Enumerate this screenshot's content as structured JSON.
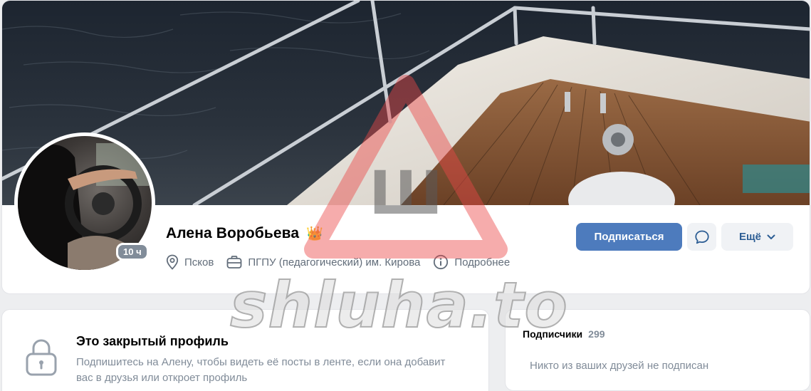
{
  "profile": {
    "name": "Алена Воробьева",
    "name_badge_icon": "crown-icon",
    "online_badge": "10 ч",
    "location": "Псков",
    "education": "ПГПУ (педагогический) им. Кирова",
    "more_info": "Подробнее"
  },
  "actions": {
    "subscribe": "Подписаться",
    "more": "Ещё"
  },
  "closed_profile": {
    "title": "Это закрытый профиль",
    "text": "Подпишитесь на Алену, чтобы видеть её посты в ленте, если она добавит вас в друзья или откроет профиль"
  },
  "followers": {
    "label": "Подписчики",
    "count": "299",
    "empty_text": "Никто из ваших друзей не подписан"
  },
  "watermark": {
    "logo_letter": "Ш",
    "text": "shluha.to"
  },
  "colors": {
    "accent": "#4d7bbd",
    "secondary_text": "#818c99",
    "page_bg": "#edeef0"
  }
}
